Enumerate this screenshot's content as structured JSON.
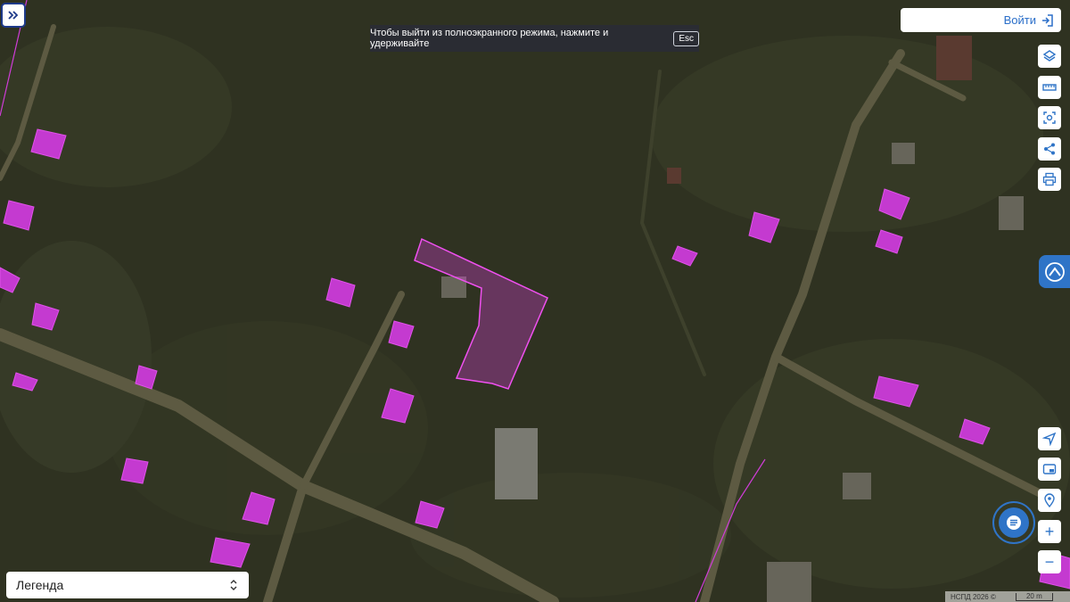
{
  "header": {
    "expand_icon": "double-chevron-right-icon",
    "login_label": "Войти",
    "login_icon": "sign-in-icon"
  },
  "fullscreen_notice": {
    "text": "Чтобы выйти из полноэкранного режима, нажмите и удерживайте",
    "key": "Esc"
  },
  "toolbar_top": [
    {
      "icon": "layers-icon"
    },
    {
      "icon": "ruler-icon"
    },
    {
      "icon": "area-select-icon"
    },
    {
      "icon": "share-icon"
    },
    {
      "icon": "print-icon"
    }
  ],
  "toolbar_bottom": [
    {
      "icon": "locate-arrow-icon"
    },
    {
      "icon": "picture-in-picture-icon"
    },
    {
      "icon": "location-pin-icon"
    },
    {
      "icon": "zoom-in-icon",
      "label": "+"
    },
    {
      "icon": "zoom-out-icon",
      "label": "−"
    }
  ],
  "legend": {
    "label": "Легенда",
    "icon": "chevron-updown-icon"
  },
  "attribution": {
    "text": "НСПД 2026 ©",
    "scale_label": "20 m"
  },
  "colors": {
    "parcel": "#e040e0",
    "buildings": "#c43ad0",
    "accent": "#2f74c7",
    "imagery": "#2f3221"
  }
}
